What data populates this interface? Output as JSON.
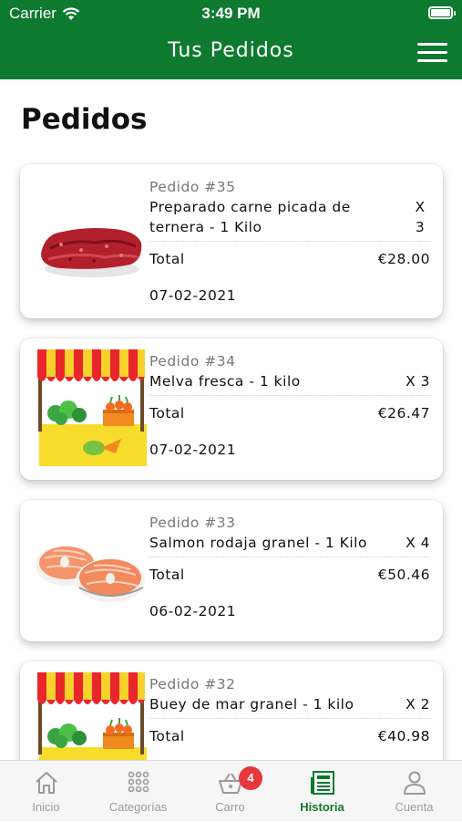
{
  "status_bar": {
    "carrier": "Carrier",
    "time": "3:49 PM"
  },
  "nav": {
    "title": "Tus Pedidos"
  },
  "page": {
    "title": "Pedidos"
  },
  "orders": [
    {
      "order_number": "Pedido #35",
      "item": "Preparado carne picada de ternera - 1 Kilo",
      "quantity": "X 3",
      "total_label": "Total",
      "total": "€28.00",
      "date": "07-02-2021",
      "image_icon": "ground-meat-image"
    },
    {
      "order_number": "Pedido #34",
      "item": "Melva fresca - 1 kilo",
      "quantity": "X 3",
      "total_label": "Total",
      "total": "€26.47",
      "date": "07-02-2021",
      "image_icon": "market-stall-image"
    },
    {
      "order_number": "Pedido #33",
      "item": "Salmon rodaja granel - 1 Kilo",
      "quantity": "X 4",
      "total_label": "Total",
      "total": "€50.46",
      "date": "06-02-2021",
      "image_icon": "salmon-steak-image"
    },
    {
      "order_number": "Pedido #32",
      "item": "Buey de mar granel - 1 kilo",
      "quantity": "X 2",
      "total_label": "Total",
      "total": "€40.98",
      "date": "",
      "image_icon": "market-stall-image"
    }
  ],
  "tab_bar": {
    "tabs": [
      {
        "label": "Inicio",
        "icon": "home-icon"
      },
      {
        "label": "Categorías",
        "icon": "grid-icon"
      },
      {
        "label": "Carro",
        "icon": "basket-icon",
        "badge": "4"
      },
      {
        "label": "Historia",
        "icon": "history-icon",
        "active": true
      },
      {
        "label": "Cuenta",
        "icon": "user-icon"
      }
    ]
  },
  "colors": {
    "brand_green": "#0e7a2f",
    "badge_red": "#e5373c",
    "inactive_tab": "#9a9a9a"
  }
}
